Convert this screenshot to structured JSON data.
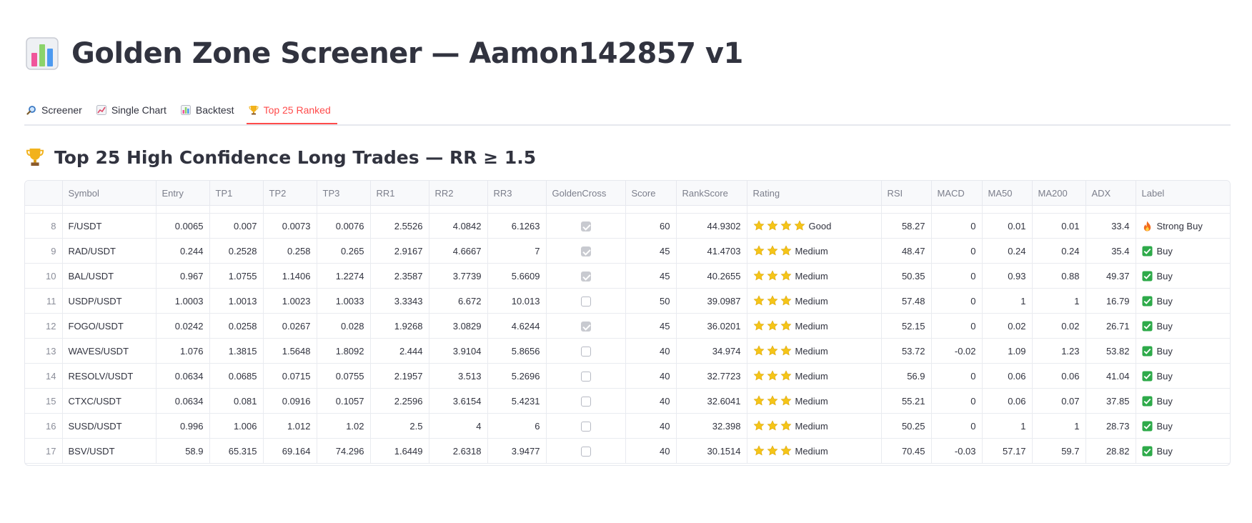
{
  "page": {
    "title": "Golden Zone Screener — Aamon142857 v1",
    "title_icon": "bar-chart-icon"
  },
  "tabs": [
    {
      "label": "Screener",
      "icon": "magnifier-icon",
      "active": false
    },
    {
      "label": "Single Chart",
      "icon": "line-chart-icon",
      "active": false
    },
    {
      "label": "Backtest",
      "icon": "bar-chart-icon",
      "active": false
    },
    {
      "label": "Top 25 Ranked",
      "icon": "trophy-icon",
      "active": true
    }
  ],
  "section": {
    "heading": "Top 25 High Confidence Long Trades — RR ≥ 1.5",
    "icon": "trophy-icon"
  },
  "colors": {
    "accent": "#ff4b4b",
    "star": "#f5c518",
    "buy_check": "#2eaa4a",
    "fire": "#f26b1d"
  },
  "table": {
    "columns": [
      "",
      "Symbol",
      "Entry",
      "TP1",
      "TP2",
      "TP3",
      "RR1",
      "RR2",
      "RR3",
      "GoldenCross",
      "Score",
      "RankScore",
      "Rating",
      "RSI",
      "MACD",
      "MA50",
      "MA200",
      "ADX",
      "Label"
    ],
    "rows": [
      {
        "idx": "8",
        "symbol": "F/USDT",
        "entry": "0.0065",
        "tp1": "0.007",
        "tp2": "0.0073",
        "tp3": "0.0076",
        "rr1": "2.5526",
        "rr2": "4.0842",
        "rr3": "6.1263",
        "golden_cross": true,
        "score": "60",
        "rank_score": "44.9302",
        "stars": 4,
        "rating": "Good",
        "rsi": "58.27",
        "macd": "0",
        "ma50": "0.01",
        "ma200": "0.01",
        "adx": "33.4",
        "label": "Strong Buy",
        "label_icon": "fire-icon"
      },
      {
        "idx": "9",
        "symbol": "RAD/USDT",
        "entry": "0.244",
        "tp1": "0.2528",
        "tp2": "0.258",
        "tp3": "0.265",
        "rr1": "2.9167",
        "rr2": "4.6667",
        "rr3": "7",
        "golden_cross": true,
        "score": "45",
        "rank_score": "41.4703",
        "stars": 3,
        "rating": "Medium",
        "rsi": "48.47",
        "macd": "0",
        "ma50": "0.24",
        "ma200": "0.24",
        "adx": "35.4",
        "label": "Buy",
        "label_icon": "check-icon"
      },
      {
        "idx": "10",
        "symbol": "BAL/USDT",
        "entry": "0.967",
        "tp1": "1.0755",
        "tp2": "1.1406",
        "tp3": "1.2274",
        "rr1": "2.3587",
        "rr2": "3.7739",
        "rr3": "5.6609",
        "golden_cross": true,
        "score": "45",
        "rank_score": "40.2655",
        "stars": 3,
        "rating": "Medium",
        "rsi": "50.35",
        "macd": "0",
        "ma50": "0.93",
        "ma200": "0.88",
        "adx": "49.37",
        "label": "Buy",
        "label_icon": "check-icon"
      },
      {
        "idx": "11",
        "symbol": "USDP/USDT",
        "entry": "1.0003",
        "tp1": "1.0013",
        "tp2": "1.0023",
        "tp3": "1.0033",
        "rr1": "3.3343",
        "rr2": "6.672",
        "rr3": "10.013",
        "golden_cross": false,
        "score": "50",
        "rank_score": "39.0987",
        "stars": 3,
        "rating": "Medium",
        "rsi": "57.48",
        "macd": "0",
        "ma50": "1",
        "ma200": "1",
        "adx": "16.79",
        "label": "Buy",
        "label_icon": "check-icon"
      },
      {
        "idx": "12",
        "symbol": "FOGO/USDT",
        "entry": "0.0242",
        "tp1": "0.0258",
        "tp2": "0.0267",
        "tp3": "0.028",
        "rr1": "1.9268",
        "rr2": "3.0829",
        "rr3": "4.6244",
        "golden_cross": true,
        "score": "45",
        "rank_score": "36.0201",
        "stars": 3,
        "rating": "Medium",
        "rsi": "52.15",
        "macd": "0",
        "ma50": "0.02",
        "ma200": "0.02",
        "adx": "26.71",
        "label": "Buy",
        "label_icon": "check-icon"
      },
      {
        "idx": "13",
        "symbol": "WAVES/USDT",
        "entry": "1.076",
        "tp1": "1.3815",
        "tp2": "1.5648",
        "tp3": "1.8092",
        "rr1": "2.444",
        "rr2": "3.9104",
        "rr3": "5.8656",
        "golden_cross": false,
        "score": "40",
        "rank_score": "34.974",
        "stars": 3,
        "rating": "Medium",
        "rsi": "53.72",
        "macd": "-0.02",
        "ma50": "1.09",
        "ma200": "1.23",
        "adx": "53.82",
        "label": "Buy",
        "label_icon": "check-icon"
      },
      {
        "idx": "14",
        "symbol": "RESOLV/USDT",
        "entry": "0.0634",
        "tp1": "0.0685",
        "tp2": "0.0715",
        "tp3": "0.0755",
        "rr1": "2.1957",
        "rr2": "3.513",
        "rr3": "5.2696",
        "golden_cross": false,
        "score": "40",
        "rank_score": "32.7723",
        "stars": 3,
        "rating": "Medium",
        "rsi": "56.9",
        "macd": "0",
        "ma50": "0.06",
        "ma200": "0.06",
        "adx": "41.04",
        "label": "Buy",
        "label_icon": "check-icon"
      },
      {
        "idx": "15",
        "symbol": "CTXC/USDT",
        "entry": "0.0634",
        "tp1": "0.081",
        "tp2": "0.0916",
        "tp3": "0.1057",
        "rr1": "2.2596",
        "rr2": "3.6154",
        "rr3": "5.4231",
        "golden_cross": false,
        "score": "40",
        "rank_score": "32.6041",
        "stars": 3,
        "rating": "Medium",
        "rsi": "55.21",
        "macd": "0",
        "ma50": "0.06",
        "ma200": "0.07",
        "adx": "37.85",
        "label": "Buy",
        "label_icon": "check-icon"
      },
      {
        "idx": "16",
        "symbol": "SUSD/USDT",
        "entry": "0.996",
        "tp1": "1.006",
        "tp2": "1.012",
        "tp3": "1.02",
        "rr1": "2.5",
        "rr2": "4",
        "rr3": "6",
        "golden_cross": false,
        "score": "40",
        "rank_score": "32.398",
        "stars": 3,
        "rating": "Medium",
        "rsi": "50.25",
        "macd": "0",
        "ma50": "1",
        "ma200": "1",
        "adx": "28.73",
        "label": "Buy",
        "label_icon": "check-icon"
      },
      {
        "idx": "17",
        "symbol": "BSV/USDT",
        "entry": "58.9",
        "tp1": "65.315",
        "tp2": "69.164",
        "tp3": "74.296",
        "rr1": "1.6449",
        "rr2": "2.6318",
        "rr3": "3.9477",
        "golden_cross": false,
        "score": "40",
        "rank_score": "30.1514",
        "stars": 3,
        "rating": "Medium",
        "rsi": "70.45",
        "macd": "-0.03",
        "ma50": "57.17",
        "ma200": "59.7",
        "adx": "28.82",
        "label": "Buy",
        "label_icon": "check-icon"
      }
    ]
  }
}
